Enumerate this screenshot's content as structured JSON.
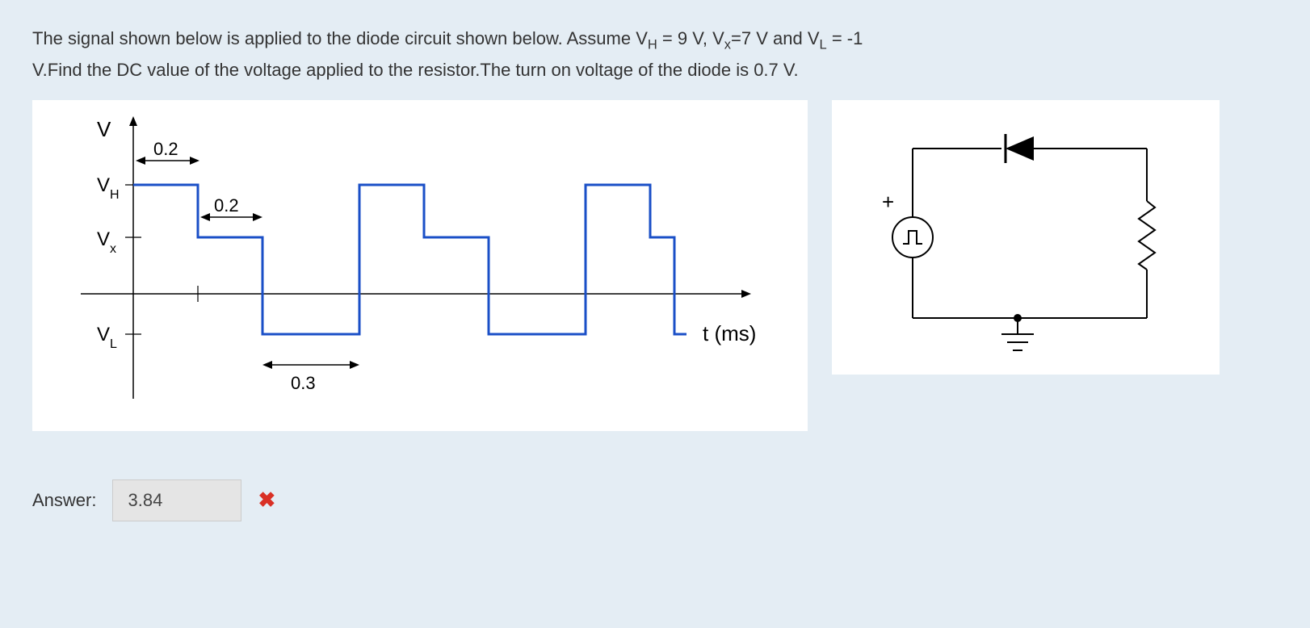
{
  "question": {
    "line1_prefix": "The signal shown below is applied to the diode circuit shown below. Assume V",
    "vh_sub": "H",
    "eq1": " = 9 V, V",
    "vx_sub": "x",
    "eq2": "=7 V and V",
    "vl_sub": "L",
    "eq3": " = -1",
    "line2": "V.Find the DC value of the voltage applied to the resistor.The turn on voltage of the diode is 0.7 V."
  },
  "waveform": {
    "y_axis_label": "V",
    "y_labels": {
      "vh": "V",
      "vh_sub": "H",
      "vx": "V",
      "vx_sub": "x",
      "vl": "V",
      "vl_sub": "L"
    },
    "x_axis_label": "t (ms)",
    "durations": {
      "d1": "0.2",
      "d2": "0.2",
      "d3": "0.3"
    }
  },
  "circuit": {
    "plus_label": "+",
    "source_symbol": "⎍"
  },
  "answer": {
    "label": "Answer:",
    "value": "3.84",
    "incorrect": true
  },
  "chart_data": {
    "type": "waveform",
    "title": "Voltage vs time",
    "xlabel": "t (ms)",
    "ylabel": "V",
    "y_levels": {
      "VH": 9,
      "Vx": 7,
      "VL": -1
    },
    "period_ms": 0.7,
    "segments": [
      {
        "level": "VH",
        "duration_ms": 0.2
      },
      {
        "level": "Vx",
        "duration_ms": 0.2
      },
      {
        "level": "VL",
        "duration_ms": 0.3
      }
    ]
  }
}
